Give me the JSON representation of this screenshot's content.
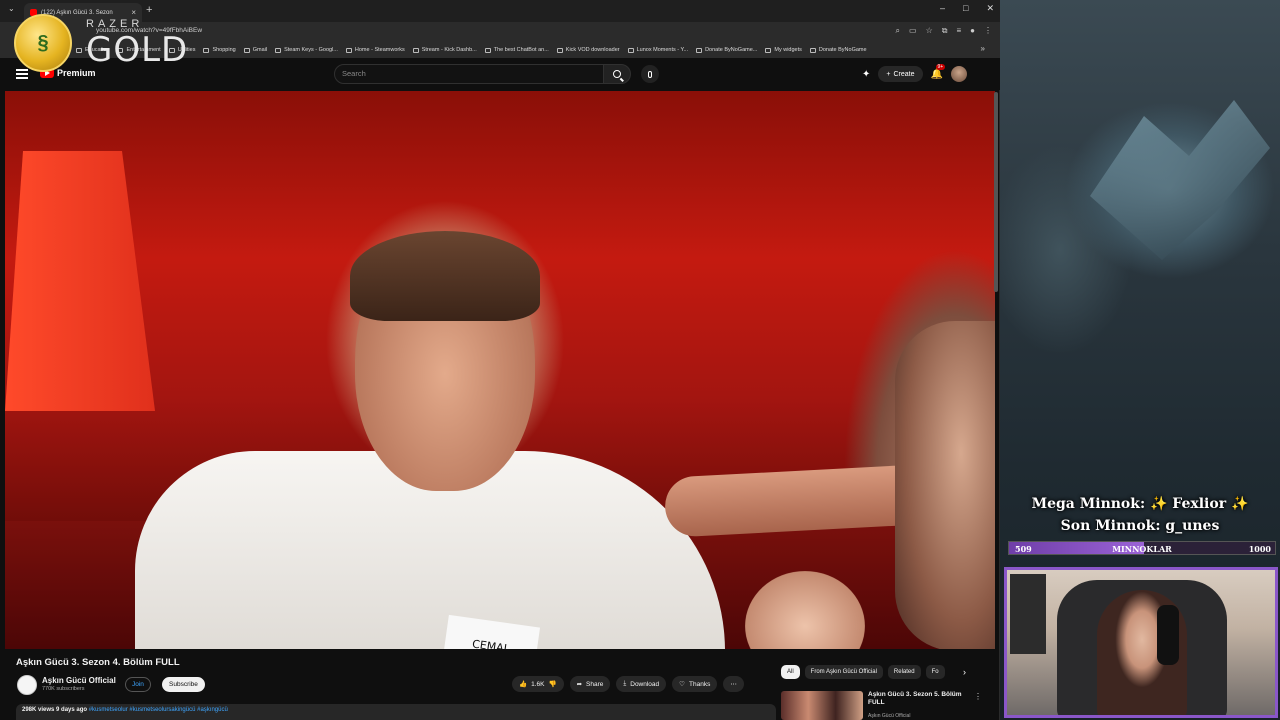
{
  "browser": {
    "tab_title": "(122) Aşkın Gücü 3. Sezon",
    "url": "youtube.com/watch?v=49fFbhAiBEw",
    "bookmarks": [
      "Education",
      "Entertainment",
      "Utilities",
      "Shopping",
      "Gmail",
      "Steam Keys - Googl...",
      "Home - Steamworks",
      "Stream - Kick Dashb...",
      "The best ChatBot an...",
      "Kick VOD downloader",
      "Lunox Moments - Y...",
      "Donate ByNoGame...",
      "My widgets",
      "Donate ByNoGame"
    ]
  },
  "overlay": {
    "razer_brand": "RAZER",
    "razer_gold": "GOLD"
  },
  "youtube": {
    "logo_label": "Premium",
    "search_placeholder": "Search",
    "create_label": "Create",
    "notification_count": "9+",
    "video_title": "Aşkın Gücü 3. Sezon 4. Bölüm FULL",
    "name_tag": "CEMAL",
    "channel_name": "Aşkın Gücü Official",
    "channel_subs": "770K subscribers",
    "join_label": "Join",
    "subscribe_label": "Subscribe",
    "likes": "1.6K",
    "share_label": "Share",
    "download_label": "Download",
    "thanks_label": "Thanks",
    "views": "298K views",
    "age": "9 days ago",
    "tags": "#kusmetseolur #kusmetseolursakingücü #aşkıngücü",
    "chips": [
      "All",
      "From Aşkın Gücü Official",
      "Related",
      "Fo"
    ],
    "recommendation": {
      "title": "Aşkın Gücü 3. Sezon 5. Bölüm FULL",
      "channel": "Aşkın Gücü Official"
    }
  },
  "stream": {
    "mega_minnok": "Mega Minnok: ✨ Fexlior ✨",
    "son_minnok": "Son Minnok: g_unes",
    "goal_label": "MINNOKLAR",
    "goal_current": "509",
    "goal_target": "1000",
    "goal_fraction": 0.509
  },
  "colors": {
    "accent_purple": "#8a57c9",
    "yt_red": "#ff0000",
    "link_blue": "#3ea6ff"
  }
}
